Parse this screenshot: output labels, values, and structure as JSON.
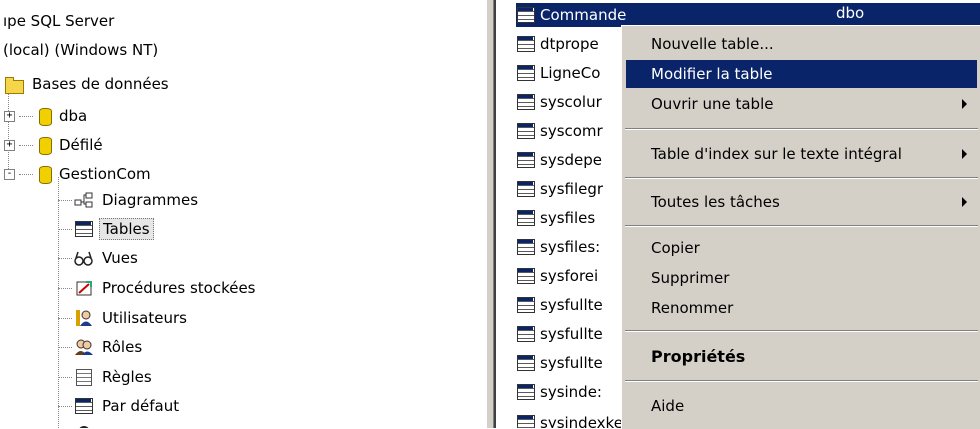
{
  "tree": {
    "items": [
      {
        "label": "ıpe SQL Server"
      },
      {
        "label": "(local) (Windows NT)"
      },
      {
        "label": "Bases de données",
        "icon": "folder-icon"
      },
      {
        "label": "dba",
        "icon": "database-icon",
        "expander": "+"
      },
      {
        "label": "Défilé",
        "icon": "database-icon",
        "expander": "+"
      },
      {
        "label": "GestionCom",
        "icon": "database-icon",
        "expander": "-"
      },
      {
        "label": "Diagrammes",
        "icon": "diagram-icon"
      },
      {
        "label": "Tables",
        "icon": "tables-icon"
      },
      {
        "label": "Vues",
        "icon": "glasses-icon"
      },
      {
        "label": "Procédures stockées",
        "icon": "procedure-icon"
      },
      {
        "label": "Utilisateurs",
        "icon": "users-icon"
      },
      {
        "label": "Rôles",
        "icon": "roles-icon"
      },
      {
        "label": "Règles",
        "icon": "rules-icon"
      },
      {
        "label": "Par défaut",
        "icon": "default-icon"
      }
    ]
  },
  "list": {
    "items": [
      "Commande",
      "dtprope",
      "LigneCo",
      "syscolur",
      "syscomr",
      "sysdepe",
      "sysfilegr",
      "sysfiles",
      "sysfiles:",
      "sysforei",
      "sysfullte",
      "sysfullte",
      "sysinde:",
      "sysindexkey"
    ],
    "selected_owner": "dbo"
  },
  "menu": {
    "items": [
      {
        "label": "Nouvelle table..."
      },
      {
        "label": "Modifier la table"
      },
      {
        "label": "Ouvrir une table"
      },
      {
        "label": "Table d'index sur le texte intégral"
      },
      {
        "label": "Toutes les tâches"
      },
      {
        "label": "Copier"
      },
      {
        "label": "Supprimer"
      },
      {
        "label": "Renommer"
      },
      {
        "label": "Propriétés"
      },
      {
        "label": "Aide"
      }
    ]
  },
  "colors": {
    "selection": "#0a246a",
    "menu_bg": "#d4d0c8"
  }
}
